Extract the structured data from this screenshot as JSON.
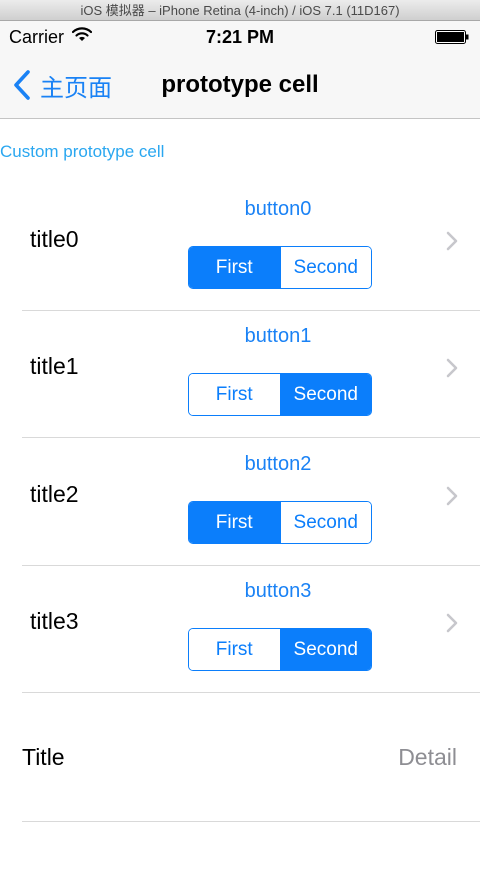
{
  "simulator": {
    "title": "iOS 模拟器 – iPhone Retina (4-inch) / iOS 7.1 (11D167)"
  },
  "status_bar": {
    "carrier": "Carrier",
    "time": "7:21 PM"
  },
  "nav": {
    "back_label": "主页面",
    "title": "prototype cell"
  },
  "section": {
    "header": "Custom prototype cell"
  },
  "cells": [
    {
      "title": "title0",
      "button": "button0",
      "segments": [
        "First",
        "Second"
      ],
      "selected_segment": "First"
    },
    {
      "title": "title1",
      "button": "button1",
      "segments": [
        "First",
        "Second"
      ],
      "selected_segment": "Second"
    },
    {
      "title": "title2",
      "button": "button2",
      "segments": [
        "First",
        "Second"
      ],
      "selected_segment": "First"
    },
    {
      "title": "title3",
      "button": "button3",
      "segments": [
        "First",
        "Second"
      ],
      "selected_segment": "Second"
    }
  ],
  "detail_cell": {
    "title": "Title",
    "detail": "Detail"
  },
  "colors": {
    "accent": "#0b7efb",
    "section_header": "#2aa7f0",
    "detail_text": "#8e8e93"
  },
  "icons": {
    "back": "chevron-left-icon",
    "wifi": "wifi-icon",
    "battery": "battery-icon",
    "disclosure": "chevron-right-icon"
  }
}
